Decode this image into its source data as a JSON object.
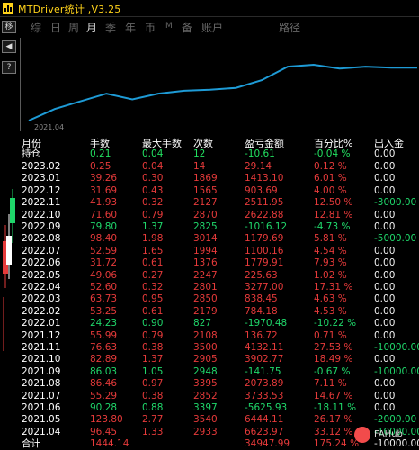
{
  "window": {
    "title": "MTDriver统计 ,V3.25",
    "icon": "app-icon"
  },
  "toolbar": {
    "buttons": [
      {
        "label": "移",
        "icon": "move-icon"
      },
      {
        "label": "◀",
        "icon": "collapse-icon"
      },
      {
        "label": "◀",
        "icon": "collapse-icon"
      },
      {
        "label": "?",
        "icon": "help-icon"
      }
    ]
  },
  "tabs": [
    {
      "label": "综",
      "active": false
    },
    {
      "label": "日",
      "active": false
    },
    {
      "label": "周",
      "active": false
    },
    {
      "label": "月",
      "active": true
    },
    {
      "label": "季",
      "active": false
    },
    {
      "label": "年",
      "active": false
    },
    {
      "label": "币",
      "active": false
    },
    {
      "label": "M",
      "active": false
    },
    {
      "label": "备",
      "active": false
    },
    {
      "label": "账户",
      "active": false
    },
    {
      "label": "路径",
      "active": false
    }
  ],
  "chart_data": {
    "type": "line",
    "x_tick_label": "2021.04",
    "color": "#1e9bd6",
    "note_y": "cumulative balance curve (relative)",
    "values": [
      2,
      14,
      22,
      30,
      24,
      30,
      33,
      34,
      36,
      44,
      58,
      60,
      56,
      58,
      57,
      57
    ]
  },
  "table": {
    "headers": [
      "月份",
      "手数",
      "最大手数",
      "次数",
      "盈亏金额",
      "百分比%",
      "出入金"
    ],
    "hold": {
      "label": "持仓",
      "lots": "0.21",
      "max": "0.04",
      "count": "12",
      "pnl": "-10.61",
      "pct": "-0.04 %",
      "flow": "0.00"
    },
    "rows": [
      {
        "m": "2023.02",
        "lots": "0.25",
        "max": "0.04",
        "count": "14",
        "pnl": "29.14",
        "pct": "0.12 %",
        "flow": "0.00",
        "color": "red"
      },
      {
        "m": "2023.01",
        "lots": "39.26",
        "max": "0.30",
        "count": "1869",
        "pnl": "1413.10",
        "pct": "6.01 %",
        "flow": "0.00",
        "color": "red"
      },
      {
        "m": "2022.12",
        "lots": "31.69",
        "max": "0.43",
        "count": "1565",
        "pnl": "903.69",
        "pct": "4.00 %",
        "flow": "0.00",
        "color": "red"
      },
      {
        "m": "2022.11",
        "lots": "41.93",
        "max": "0.32",
        "count": "2127",
        "pnl": "2511.95",
        "pct": "12.50 %",
        "flow": "-3000.00",
        "color": "red",
        "flow_color": "green"
      },
      {
        "m": "2022.10",
        "lots": "71.60",
        "max": "0.79",
        "count": "2870",
        "pnl": "2622.88",
        "pct": "12.81 %",
        "flow": "0.00",
        "color": "red"
      },
      {
        "m": "2022.09",
        "lots": "79.80",
        "max": "1.37",
        "count": "2825",
        "pnl": "-1016.12",
        "pct": "-4.73 %",
        "flow": "0.00",
        "color": "green"
      },
      {
        "m": "2022.08",
        "lots": "98.40",
        "max": "1.98",
        "count": "3014",
        "pnl": "1179.69",
        "pct": "5.81 %",
        "flow": "-5000.00",
        "color": "red",
        "flow_color": "green"
      },
      {
        "m": "2022.07",
        "lots": "52.59",
        "max": "1.65",
        "count": "1994",
        "pnl": "1100.16",
        "pct": "4.54 %",
        "flow": "0.00",
        "color": "red"
      },
      {
        "m": "2022.06",
        "lots": "31.72",
        "max": "0.61",
        "count": "1376",
        "pnl": "1779.91",
        "pct": "7.93 %",
        "flow": "0.00",
        "color": "red"
      },
      {
        "m": "2022.05",
        "lots": "49.06",
        "max": "0.27",
        "count": "2247",
        "pnl": "225.63",
        "pct": "1.02 %",
        "flow": "0.00",
        "color": "red"
      },
      {
        "m": "2022.04",
        "lots": "52.60",
        "max": "0.32",
        "count": "2801",
        "pnl": "3277.00",
        "pct": "17.31 %",
        "flow": "0.00",
        "color": "red"
      },
      {
        "m": "2022.03",
        "lots": "63.73",
        "max": "0.95",
        "count": "2850",
        "pnl": "838.45",
        "pct": "4.63 %",
        "flow": "0.00",
        "color": "red"
      },
      {
        "m": "2022.02",
        "lots": "53.25",
        "max": "0.61",
        "count": "2179",
        "pnl": "784.18",
        "pct": "4.53 %",
        "flow": "0.00",
        "color": "red"
      },
      {
        "m": "2022.01",
        "lots": "24.23",
        "max": "0.90",
        "count": "827",
        "pnl": "-1970.48",
        "pct": "-10.22 %",
        "flow": "0.00",
        "color": "green"
      },
      {
        "m": "2021.12",
        "lots": "55.99",
        "max": "0.79",
        "count": "2108",
        "pnl": "136.72",
        "pct": "0.71 %",
        "flow": "0.00",
        "color": "red"
      },
      {
        "m": "2021.11",
        "lots": "76.63",
        "max": "0.38",
        "count": "3500",
        "pnl": "4132.11",
        "pct": "27.53 %",
        "flow": "-10000.00",
        "color": "red",
        "flow_color": "green"
      },
      {
        "m": "2021.10",
        "lots": "82.89",
        "max": "1.37",
        "count": "2905",
        "pnl": "3902.77",
        "pct": "18.49 %",
        "flow": "0.00",
        "color": "red"
      },
      {
        "m": "2021.09",
        "lots": "86.03",
        "max": "1.05",
        "count": "2948",
        "pnl": "-141.75",
        "pct": "-0.67 %",
        "flow": "-10000.00",
        "color": "green",
        "flow_color": "green"
      },
      {
        "m": "2021.08",
        "lots": "86.46",
        "max": "0.97",
        "count": "3395",
        "pnl": "2073.89",
        "pct": "7.11 %",
        "flow": "0.00",
        "color": "red"
      },
      {
        "m": "2021.07",
        "lots": "55.29",
        "max": "0.38",
        "count": "2852",
        "pnl": "3733.53",
        "pct": "14.67 %",
        "flow": "0.00",
        "color": "red"
      },
      {
        "m": "2021.06",
        "lots": "90.28",
        "max": "0.88",
        "count": "3397",
        "pnl": "-5625.93",
        "pct": "-18.11 %",
        "flow": "0.00",
        "color": "green"
      },
      {
        "m": "2021.05",
        "lots": "123.80",
        "max": "2.77",
        "count": "3540",
        "pnl": "6444.11",
        "pct": "26.17 %",
        "flow": "-2000.00",
        "color": "red",
        "flow_color": "green"
      },
      {
        "m": "2021.04",
        "lots": "96.45",
        "max": "1.33",
        "count": "2933",
        "pnl": "6623.97",
        "pct": "33.12 %",
        "flow": "-10000.00",
        "color": "red",
        "flow_color": "green"
      }
    ],
    "total": {
      "label": "合计",
      "lots": "1444.14",
      "count": "",
      "pnl": "34947.99",
      "pct": "175.24 %",
      "flow": "-10000.00"
    }
  },
  "watermark": {
    "text": "FAHub",
    "icon": "brand-logo-icon"
  }
}
